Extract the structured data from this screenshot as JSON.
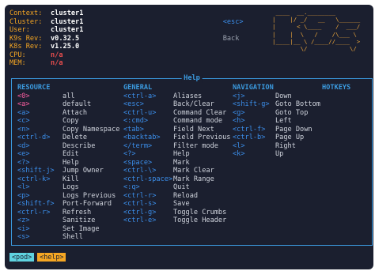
{
  "info": [
    {
      "label": "Context:",
      "value": "cluster1",
      "na": false
    },
    {
      "label": "Cluster:",
      "value": "cluster1",
      "na": false
    },
    {
      "label": "User:",
      "value": "cluster1",
      "na": false
    },
    {
      "label": "K9s Rev:",
      "value": "v0.32.5",
      "na": false
    },
    {
      "label": "K8s Rev:",
      "value": "v1.25.0",
      "na": false
    },
    {
      "label": "CPU:",
      "value": "n/a",
      "na": true
    },
    {
      "label": "MEM:",
      "value": "n/a",
      "na": true
    }
  ],
  "menu_hint": {
    "key": "<esc>",
    "label": "Back"
  },
  "logo": " ____  __.________       \n|    |/ _/   __   \\______\n|      < \\____    /  ___/\n|    |  \\   /    /\\___ \\ \n|____|__ \\ /____//____  >\n        \\/            \\/ ",
  "help": {
    "title": "Help",
    "resource": {
      "header": "RESOURCE",
      "rows": [
        {
          "key": "<0>",
          "desc": "all",
          "selected": true
        },
        {
          "key": "<a>",
          "desc": "default",
          "selected": true
        },
        {
          "key": "<a>",
          "desc": "Attach"
        },
        {
          "key": "<c>",
          "desc": "Copy"
        },
        {
          "key": "<n>",
          "desc": "Copy Namespace"
        },
        {
          "key": "<ctrl-d>",
          "desc": "Delete"
        },
        {
          "key": "<d>",
          "desc": "Describe"
        },
        {
          "key": "<e>",
          "desc": "Edit"
        },
        {
          "key": "<?>",
          "desc": "Help"
        },
        {
          "key": "<shift-j>",
          "desc": "Jump Owner"
        },
        {
          "key": "<ctrl-k>",
          "desc": "Kill"
        },
        {
          "key": "<l>",
          "desc": "Logs"
        },
        {
          "key": "<p>",
          "desc": "Logs Previous"
        },
        {
          "key": "<shift-f>",
          "desc": "Port-Forward"
        },
        {
          "key": "<ctrl-r>",
          "desc": "Refresh"
        },
        {
          "key": "<z>",
          "desc": "Sanitize"
        },
        {
          "key": "<i>",
          "desc": "Set Image"
        },
        {
          "key": "<s>",
          "desc": "Shell"
        }
      ]
    },
    "general": {
      "header": "GENERAL",
      "rows": [
        {
          "key": "<ctrl-a>",
          "desc": "Aliases"
        },
        {
          "key": "<esc>",
          "desc": "Back/Clear"
        },
        {
          "key": "<ctrl-u>",
          "desc": "Command Clear"
        },
        {
          "key": "<:cmd>",
          "desc": "Command mode"
        },
        {
          "key": "<tab>",
          "desc": "Field Next"
        },
        {
          "key": "<backtab>",
          "desc": "Field Previous"
        },
        {
          "key": "</term>",
          "desc": "Filter mode"
        },
        {
          "key": "<?>",
          "desc": "Help"
        },
        {
          "key": "<space>",
          "desc": "Mark"
        },
        {
          "key": "<ctrl-\\>",
          "desc": "Mark Clear"
        },
        {
          "key": "<ctrl-space>",
          "desc": "Mark Range"
        },
        {
          "key": "<:q>",
          "desc": "Quit"
        },
        {
          "key": "<ctrl-r>",
          "desc": "Reload"
        },
        {
          "key": "<ctrl-s>",
          "desc": "Save"
        },
        {
          "key": "<ctrl-g>",
          "desc": "Toggle Crumbs"
        },
        {
          "key": "<ctrl-e>",
          "desc": "Toggle Header"
        }
      ]
    },
    "navigation": {
      "header": "NAVIGATION",
      "rows": [
        {
          "key": "<j>",
          "desc": "Down"
        },
        {
          "key": "<shift-g>",
          "desc": "Goto Bottom"
        },
        {
          "key": "<g>",
          "desc": "Goto Top"
        },
        {
          "key": "<h>",
          "desc": "Left"
        },
        {
          "key": "<ctrl-f>",
          "desc": "Page Down"
        },
        {
          "key": "<ctrl-b>",
          "desc": "Page Up"
        },
        {
          "key": "<l>",
          "desc": "Right"
        },
        {
          "key": "<k>",
          "desc": "Up"
        }
      ]
    },
    "hotkeys": {
      "header": "HOTKEYS"
    }
  },
  "crumbs": [
    "<pod>",
    "<help>"
  ],
  "colors": {
    "background": "#1b1f2f",
    "key": "#3b8eea",
    "selected_key": "#ff5fa2",
    "header": "#3b9adf",
    "label": "#f5a623",
    "na": "#e64d4d",
    "crumb_pod": "#5fd3e0",
    "crumb_help": "#f5a623"
  }
}
